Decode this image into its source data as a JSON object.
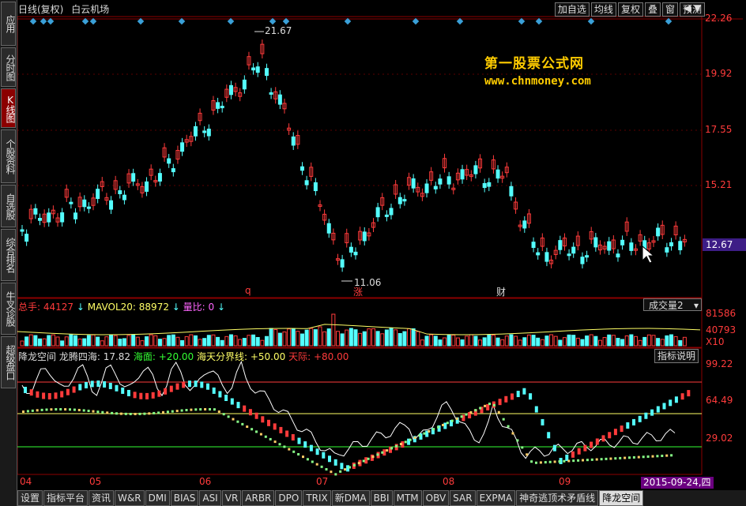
{
  "sidebar": {
    "tabs": [
      {
        "label": "应用",
        "active": false
      },
      {
        "label": "分时图",
        "active": false
      },
      {
        "label": "K线图",
        "active": true
      },
      {
        "label": "个股资料",
        "active": false
      },
      {
        "label": "自选股",
        "active": false
      },
      {
        "label": "综合排名",
        "active": false
      },
      {
        "label": "牛叉诊股",
        "active": false
      },
      {
        "label": "超级盘口",
        "active": false
      }
    ]
  },
  "header": {
    "period": "日线(复权)",
    "stock_name": "白云机场",
    "toolbar": [
      "加自选",
      "均线",
      "复权",
      "叠",
      "窗",
      "预测"
    ],
    "arrows": "◀ ▼"
  },
  "watermark": {
    "title": "第一股票公式网",
    "url": "www.chnmoney.com"
  },
  "price_axis": [
    "22.26",
    "19.92",
    "17.55",
    "15.21"
  ],
  "current_price": "12.67",
  "annotations": {
    "high": "21.67",
    "low": "11.06",
    "marker_q": "q",
    "marker_zhang": "涨",
    "marker_cai": "财"
  },
  "volume_panel": {
    "total_label": "总手: 44127",
    "mavol_label": "MAVOL20: 88972",
    "ratio_label": "量比: 0",
    "selector": "成交量2",
    "axis": [
      "81586",
      "40793",
      "X10"
    ]
  },
  "indicator_panel": {
    "name": "降龙空间",
    "dragon_label": "龙腾四海: 17.82",
    "sea_label": "海面: +20.00",
    "boundary_label": "海天分界线: +50.00",
    "sky_label": "天际: +80.00",
    "explain_button": "指标说明",
    "axis": [
      "99.22",
      "64.49",
      "29.02"
    ]
  },
  "x_axis": [
    "04",
    "05",
    "06",
    "07",
    "08",
    "09"
  ],
  "date_label": "2015-09-24,四",
  "bottom_tabs": [
    "设置",
    "指标平台",
    "资讯",
    "W&R",
    "DMI",
    "BIAS",
    "ASI",
    "VR",
    "ARBR",
    "DPO",
    "TRIX",
    "新DMA",
    "BBI",
    "MTM",
    "OBV",
    "SAR",
    "EXPMA",
    "神奇逃顶术矛盾线",
    "降龙空间"
  ],
  "active_bottom_tab": "降龙空间",
  "colors": {
    "up": "#ff3b3b",
    "down": "#54ffff",
    "axis_text": "#ff3b3b",
    "border": "#8b0000",
    "watermark": "#ffcc00",
    "diamond": "#3aa0d8"
  }
}
